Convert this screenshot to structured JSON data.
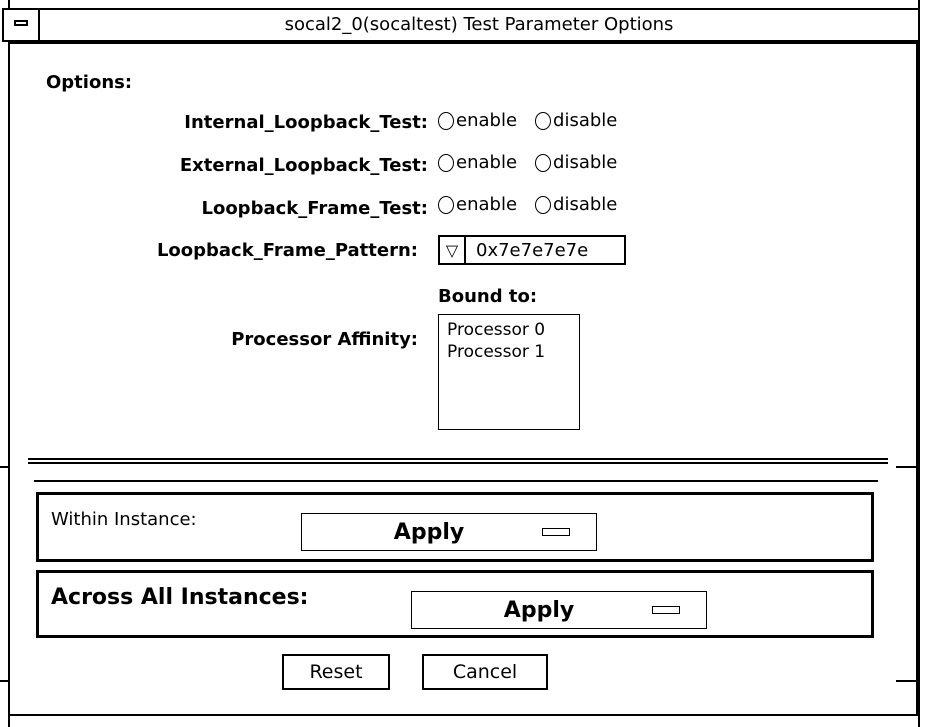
{
  "window": {
    "title": "socal2_0(socaltest) Test Parameter Options"
  },
  "options": {
    "heading": "Options:",
    "rows": [
      {
        "label": "Internal_Loopback_Test:",
        "enable_label": "enable",
        "disable_label": "disable"
      },
      {
        "label": "External_Loopback_Test:",
        "enable_label": "enable",
        "disable_label": "disable"
      },
      {
        "label": "Loopback_Frame_Test:",
        "enable_label": "enable",
        "disable_label": "disable"
      }
    ],
    "pattern": {
      "label": "Loopback_Frame_Pattern:",
      "value": "0x7e7e7e7e"
    },
    "affinity": {
      "label": "Processor Affinity:",
      "bound_label": "Bound to:",
      "items": [
        "Processor 0",
        "Processor 1"
      ]
    }
  },
  "within": {
    "label": "Within Instance:",
    "button": "Apply"
  },
  "across": {
    "label": "Across All Instances:",
    "button": "Apply"
  },
  "buttons": {
    "reset": "Reset",
    "cancel": "Cancel"
  }
}
